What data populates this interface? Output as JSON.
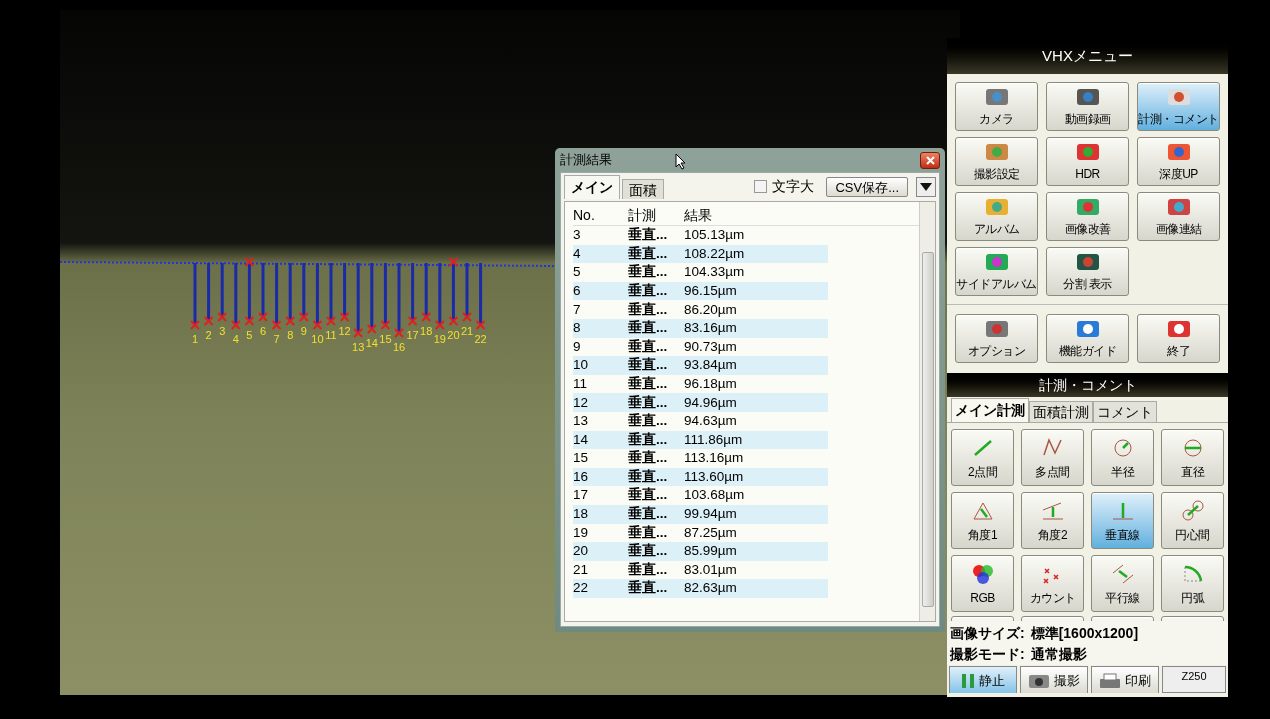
{
  "overlay": {
    "labels": [
      "1",
      "2",
      "3",
      "4",
      "5",
      "6",
      "7",
      "8",
      "9",
      "10",
      "11",
      "12",
      "13",
      "14",
      "15",
      "16",
      "17",
      "18",
      "19",
      "20",
      "21",
      "22"
    ]
  },
  "results": {
    "title": "計測結果",
    "tabs": [
      {
        "label": "メイン",
        "selected": true
      },
      {
        "label": "面積",
        "selected": false
      }
    ],
    "large_text": {
      "label": "文字大",
      "checked": false
    },
    "csv_button": "CSV保存...",
    "columns": [
      "No.",
      "計測",
      "結果"
    ],
    "rows": [
      {
        "no": "3",
        "type": "垂直...",
        "result": "105.13µm"
      },
      {
        "no": "4",
        "type": "垂直...",
        "result": "108.22µm"
      },
      {
        "no": "5",
        "type": "垂直...",
        "result": "104.33µm"
      },
      {
        "no": "6",
        "type": "垂直...",
        "result": "96.15µm"
      },
      {
        "no": "7",
        "type": "垂直...",
        "result": "86.20µm"
      },
      {
        "no": "8",
        "type": "垂直...",
        "result": "83.16µm"
      },
      {
        "no": "9",
        "type": "垂直...",
        "result": "90.73µm"
      },
      {
        "no": "10",
        "type": "垂直...",
        "result": "93.84µm"
      },
      {
        "no": "11",
        "type": "垂直...",
        "result": "96.18µm"
      },
      {
        "no": "12",
        "type": "垂直...",
        "result": "94.96µm"
      },
      {
        "no": "13",
        "type": "垂直...",
        "result": "94.63µm"
      },
      {
        "no": "14",
        "type": "垂直...",
        "result": "111.86µm"
      },
      {
        "no": "15",
        "type": "垂直...",
        "result": "113.16µm"
      },
      {
        "no": "16",
        "type": "垂直...",
        "result": "113.60µm"
      },
      {
        "no": "17",
        "type": "垂直...",
        "result": "103.68µm"
      },
      {
        "no": "18",
        "type": "垂直...",
        "result": "99.94µm"
      },
      {
        "no": "19",
        "type": "垂直...",
        "result": "87.25µm"
      },
      {
        "no": "20",
        "type": "垂直...",
        "result": "85.99µm"
      },
      {
        "no": "21",
        "type": "垂直...",
        "result": "83.01µm"
      },
      {
        "no": "22",
        "type": "垂直...",
        "result": "82.63µm"
      }
    ]
  },
  "menu": {
    "title": "VHXメニュー",
    "items": [
      {
        "label": "カメラ",
        "kind": "camera",
        "selected": false
      },
      {
        "label": "動画録画",
        "kind": "video",
        "selected": false
      },
      {
        "label": "計測・コメント",
        "kind": "ruler",
        "selected": true
      },
      {
        "label": "撮影設定",
        "kind": "photo",
        "selected": false
      },
      {
        "label": "HDR",
        "kind": "hdr",
        "selected": false
      },
      {
        "label": "深度UP",
        "kind": "depth",
        "selected": false
      },
      {
        "label": "アルバム",
        "kind": "folder",
        "selected": false
      },
      {
        "label": "画像改善",
        "kind": "image",
        "selected": false
      },
      {
        "label": "画像連結",
        "kind": "stitch",
        "selected": false
      },
      {
        "label": "サイドアルバム",
        "kind": "side",
        "selected": false
      },
      {
        "label": "分割 表示",
        "kind": "split",
        "selected": false
      }
    ],
    "system": [
      {
        "label": "オプション",
        "kind": "tools"
      },
      {
        "label": "機能ガイド",
        "kind": "help"
      },
      {
        "label": "終了",
        "kind": "power"
      }
    ]
  },
  "measure": {
    "title": "計測・コメント",
    "tabs": [
      {
        "label": "メイン計測",
        "selected": true
      },
      {
        "label": "面積計測",
        "selected": false
      },
      {
        "label": "コメント",
        "selected": false
      }
    ],
    "tools": [
      {
        "label": "2点間",
        "kind": "line",
        "selected": false
      },
      {
        "label": "多点間",
        "kind": "multi",
        "selected": false
      },
      {
        "label": "半径",
        "kind": "radius",
        "selected": false
      },
      {
        "label": "直径",
        "kind": "diameter",
        "selected": false
      },
      {
        "label": "角度1",
        "kind": "angle",
        "selected": false
      },
      {
        "label": "角度2",
        "kind": "angle2",
        "selected": false
      },
      {
        "label": "垂直線",
        "kind": "perp",
        "selected": true
      },
      {
        "label": "円心間",
        "kind": "centers",
        "selected": false
      },
      {
        "label": "RGB",
        "kind": "rgb",
        "selected": false
      },
      {
        "label": "カウント",
        "kind": "count",
        "selected": false
      },
      {
        "label": "平行線",
        "kind": "parallel",
        "selected": false
      },
      {
        "label": "円弧",
        "kind": "arc",
        "selected": false
      }
    ]
  },
  "status": {
    "lines": [
      {
        "label": "画像サイズ:",
        "value": "標準[1600x1200]"
      },
      {
        "label": "撮影モード:",
        "value": "通常撮影"
      }
    ]
  },
  "bottom_buttons": [
    {
      "label": "静止",
      "kind": "freeze",
      "selected": true
    },
    {
      "label": "撮影",
      "kind": "camera",
      "selected": false
    },
    {
      "label": "印刷",
      "kind": "print",
      "selected": false
    }
  ],
  "zoom_readout": "Z250"
}
